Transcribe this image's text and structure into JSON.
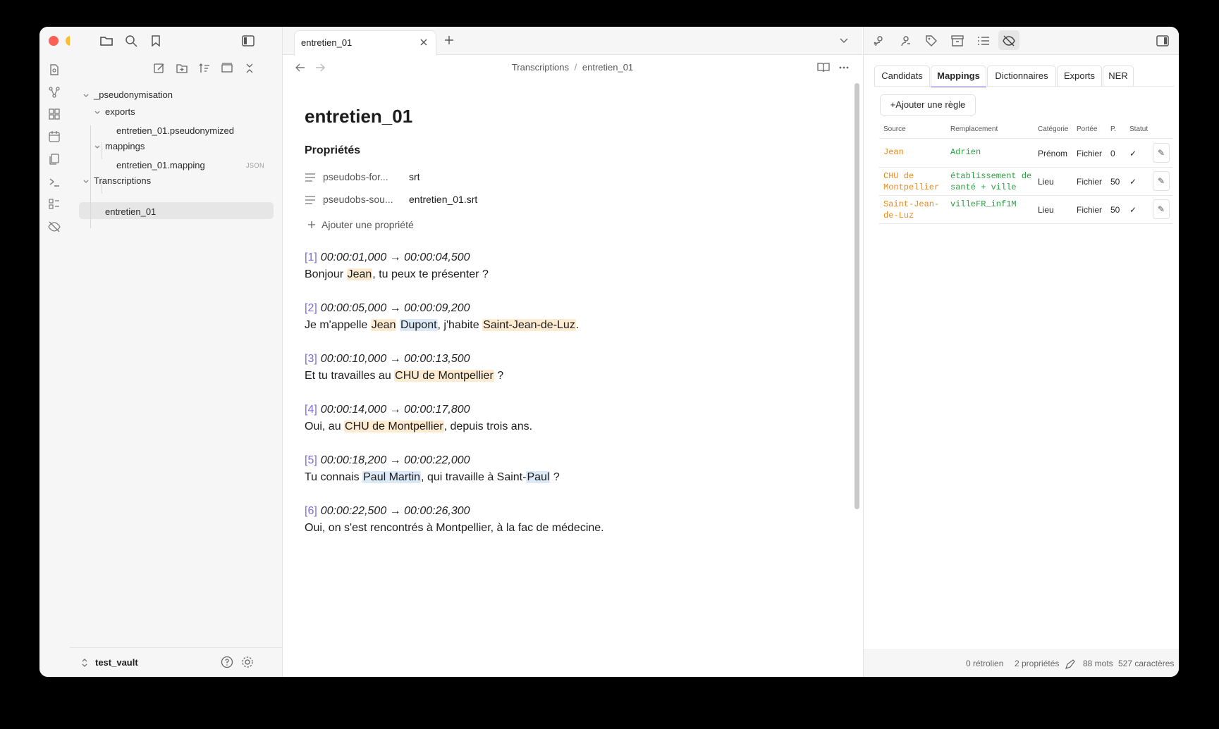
{
  "sidebar": {
    "tree": [
      {
        "label": "_pseudonymisation"
      },
      {
        "label": "exports"
      },
      {
        "label": "entretien_01.pseudonymized"
      },
      {
        "label": "mappings"
      },
      {
        "label": "entretien_01.mapping",
        "badge": "JSON"
      },
      {
        "label": "Transcriptions"
      },
      {
        "label": "entretien_01"
      }
    ],
    "vault_name": "test_vault"
  },
  "editor": {
    "tab_title": "entretien_01",
    "breadcrumb_parent": "Transcriptions",
    "breadcrumb_sep": "/",
    "breadcrumb_current": "entretien_01",
    "title": "entretien_01",
    "properties_heading": "Propriétés",
    "properties": [
      {
        "key": "pseudobs-for...",
        "value": "srt"
      },
      {
        "key": "pseudobs-sou...",
        "value": "entretien_01.srt"
      }
    ],
    "add_property_label": "Ajouter une propriété",
    "segments": [
      {
        "idx": "[1]",
        "ts": "00:00:01,000 → 00:00:04,500",
        "parts": [
          {
            "t": "Bonjour "
          },
          {
            "t": "Jean",
            "hl": "o"
          },
          {
            "t": ", tu peux te présenter ?"
          }
        ]
      },
      {
        "idx": "[2]",
        "ts": "00:00:05,000 → 00:00:09,200",
        "parts": [
          {
            "t": "Je m'appelle "
          },
          {
            "t": "Jean",
            "hl": "o"
          },
          {
            "t": " "
          },
          {
            "t": "Dupont",
            "hl": "b"
          },
          {
            "t": ", j'habite "
          },
          {
            "t": "Saint-Jean-de-Luz",
            "hl": "o"
          },
          {
            "t": "."
          }
        ]
      },
      {
        "idx": "[3]",
        "ts": "00:00:10,000 → 00:00:13,500",
        "parts": [
          {
            "t": "Et tu travailles au "
          },
          {
            "t": "CHU de Montpellier",
            "hl": "o"
          },
          {
            "t": " ?"
          }
        ]
      },
      {
        "idx": "[4]",
        "ts": "00:00:14,000 → 00:00:17,800",
        "parts": [
          {
            "t": "Oui, au "
          },
          {
            "t": "CHU de Montpellier",
            "hl": "o"
          },
          {
            "t": ", depuis trois ans."
          }
        ]
      },
      {
        "idx": "[5]",
        "ts": "00:00:18,200 → 00:00:22,000",
        "parts": [
          {
            "t": "Tu connais "
          },
          {
            "t": "Paul Martin",
            "hl": "b"
          },
          {
            "t": ", qui travaille à Saint-"
          },
          {
            "t": "Paul",
            "hl": "b"
          },
          {
            "t": " ?"
          }
        ]
      },
      {
        "idx": "[6]",
        "ts": "00:00:22,500 → 00:00:26,300",
        "parts": [
          {
            "t": "Oui, on s'est rencontrés à Montpellier, à la fac de médecine."
          }
        ]
      }
    ]
  },
  "panel": {
    "tabs": [
      "Candidats",
      "Mappings",
      "Dictionnaires",
      "Exports",
      "NER"
    ],
    "active_tab": "Mappings",
    "add_rule_label": "+Ajouter une règle",
    "columns": [
      "Source",
      "Remplacement",
      "Catégorie",
      "Portée",
      "P.",
      "Statut"
    ],
    "rows": [
      {
        "source": "Jean",
        "replacement": "Adrien",
        "category": "Prénom",
        "scope": "Fichier",
        "priority": "0",
        "status": "✓"
      },
      {
        "source": "CHU de\nMontpellier",
        "replacement": "établissement de\nsanté + ville",
        "category": "Lieu",
        "scope": "Fichier",
        "priority": "50",
        "status": "✓"
      },
      {
        "source": "Saint-Jean-\nde-Luz",
        "replacement": "villeFR_inf1M",
        "category": "Lieu",
        "scope": "Fichier",
        "priority": "50",
        "status": "✓"
      }
    ],
    "edit_icon": "✎"
  },
  "statusbar": {
    "backlinks": "0 rétrolien",
    "properties": "2 propriétés",
    "words": "88 mots",
    "chars": "527 caractères"
  },
  "colors": {
    "accent": "#7b6cd9",
    "highlight_orange": "#fdebd1",
    "highlight_blue": "#dce9f7",
    "source_orange": "#e8891a",
    "replacement_green": "#2ea043"
  }
}
